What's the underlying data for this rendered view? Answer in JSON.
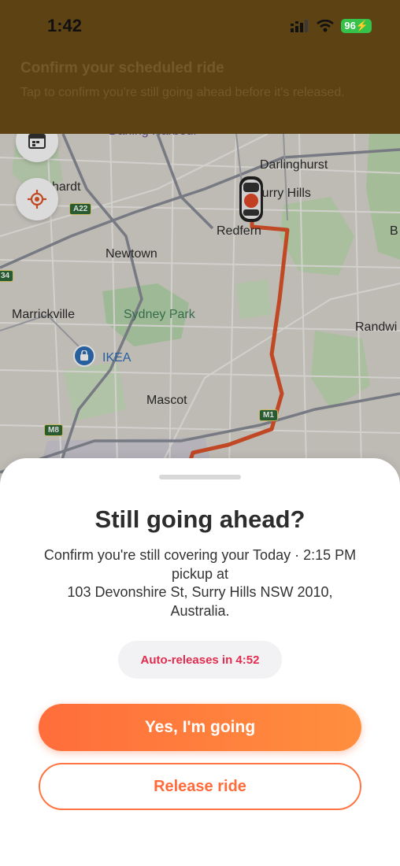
{
  "status_bar": {
    "time": "1:42",
    "battery": "96"
  },
  "banner": {
    "title": "Confirm your scheduled ride",
    "subtitle": "Tap to confirm you're still going ahead before it's released."
  },
  "map": {
    "labels": {
      "darling_harbour": "Darling Harbour",
      "darlinghurst": "Darlinghurst",
      "surry_hills": "Surry Hills",
      "erskineville": "hardt",
      "redfern": "Redfern",
      "newtown": "Newtown",
      "marrickville": "Marrickville",
      "sydney_park": "Sydney Park",
      "ikea": "IKEA",
      "mascot": "Mascot",
      "randwick": "Randwi",
      "bondi": "B"
    },
    "road_badges": {
      "a22": "A22",
      "a34": "34",
      "m1": "M1",
      "m8": "M8"
    },
    "colors": {
      "route": "#e0542a",
      "park": "#b9d8ae",
      "water": "#9fc8e8"
    },
    "icons": [
      "calendar-icon",
      "location-target-icon",
      "car-icon",
      "ikea-pin-icon"
    ]
  },
  "sheet": {
    "title": "Still going ahead?",
    "message": "Confirm you're still covering your Today · 2:15 PM pickup at\n103 Devonshire St, Surry Hills NSW 2010, Australia.",
    "timer": "Auto-releases in 4:52",
    "confirm_label": "Yes, I'm going",
    "release_label": "Release ride"
  },
  "theme": {
    "accent": "#ff7a3d",
    "timer_text": "#e02d4f",
    "banner_bg": "#5d4313"
  }
}
